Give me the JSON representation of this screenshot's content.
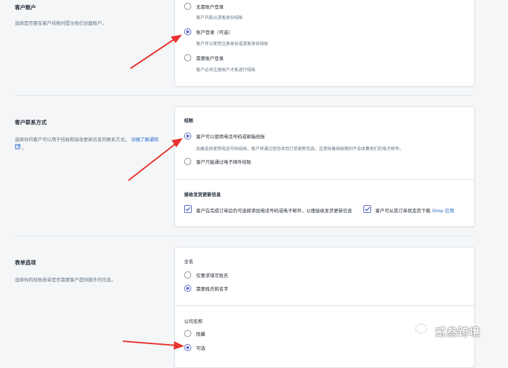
{
  "accounts": {
    "title": "客户账户",
    "description": "选择是否要在客户结账时提示他们创建账户。",
    "options": [
      {
        "label": "无需账户登录",
        "help": "客户只能以游客身份结账",
        "selected": false
      },
      {
        "label": "账户登录（可选）",
        "help": "客户可以使用注册身份或游客身份结账",
        "selected": true
      },
      {
        "label": "需要账户登录",
        "help": "客户必须注册账户才能进行结账",
        "selected": false
      }
    ]
  },
  "contact": {
    "title": "客户联系方式",
    "description": "选择你的客户可以用于结账和接收更新信息的联系方式。",
    "link_text": "详细了解通知",
    "link_suffix": "。",
    "checkout_heading": "结账",
    "options": [
      {
        "label": "客户可以使用电话号码或邮箱结账",
        "help": "如果选择使用电话号码结账，客户将通过短信收到订单更新信息。这意味着结账期间不会收集他们的电子邮件。",
        "selected": true
      },
      {
        "label": "客户只能通过电子邮件结账",
        "help": "",
        "selected": false
      }
    ],
    "updates_heading": "接收发货更新信息",
    "checkboxes": [
      {
        "label": "客户在完成订单后仍可选择添加电话号码或电子邮件，以便接收发货更新信息",
        "checked": true
      },
      {
        "label_prefix": "客户可从其订单状态页下载 ",
        "label_link": "Shop 应用",
        "checked": true
      }
    ]
  },
  "form": {
    "title": "表单选项",
    "description": "选择你的结账表单是否需要客户提供额外的信息。",
    "fullname_heading": "全名",
    "fullname_options": [
      {
        "label": "仅要求填写姓氏",
        "selected": false
      },
      {
        "label": "需要姓氏和名字",
        "selected": true
      }
    ],
    "company_heading": "公司名称",
    "company_options": [
      {
        "label": "隐藏",
        "selected": false
      },
      {
        "label": "可选",
        "selected": true
      }
    ]
  },
  "watermark": {
    "text": "贰叁跨境",
    "icon": "wechat-icon"
  },
  "colors": {
    "accent": "#5c6ac4",
    "arrow": "#e8332f",
    "link": "#2c6ecb"
  }
}
